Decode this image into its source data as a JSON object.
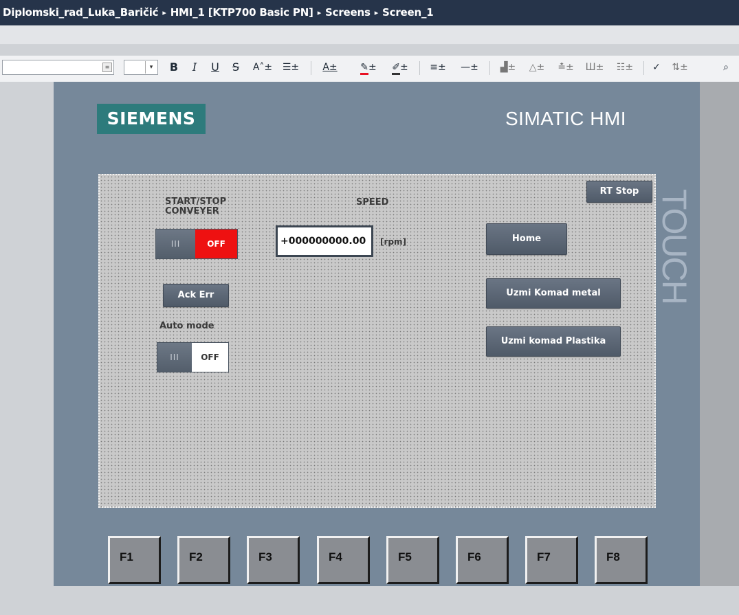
{
  "breadcrumb": {
    "project": "Diplomski_rad_Luka_Baričić",
    "device": "HMI_1 [KTP700 Basic PN]",
    "folder": "Screens",
    "screen": "Screen_1",
    "separator": "▸"
  },
  "toolbar": {
    "bold": "B",
    "italic": "I",
    "underline": "U",
    "strikethrough": "S"
  },
  "device_panel": {
    "brand_logo": "SIEMENS",
    "product_name": "SIMATIC HMI",
    "side_label": "TOUCH",
    "colors": {
      "panel": "#76889a",
      "brand": "#2d7b7c"
    }
  },
  "screen": {
    "start_stop_label": "START/STOP\nCONVEYER",
    "start_stop_switch": {
      "grip": "III",
      "state": "OFF",
      "state_color": "#ee1111"
    },
    "speed_label": "SPEED",
    "speed_value": "+000000000.00",
    "speed_unit": "[rpm]",
    "ack_err_button": "Ack Err",
    "auto_mode_label": "Auto mode",
    "auto_mode_switch": {
      "grip": "III",
      "state": "OFF",
      "state_color": "#ffffff"
    },
    "rt_stop_button": "RT Stop",
    "home_button": "Home",
    "metal_button": "Uzmi Komad metal",
    "plastic_button": "Uzmi komad Plastika"
  },
  "function_keys": [
    "F1",
    "F2",
    "F3",
    "F4",
    "F5",
    "F6",
    "F7",
    "F8"
  ]
}
